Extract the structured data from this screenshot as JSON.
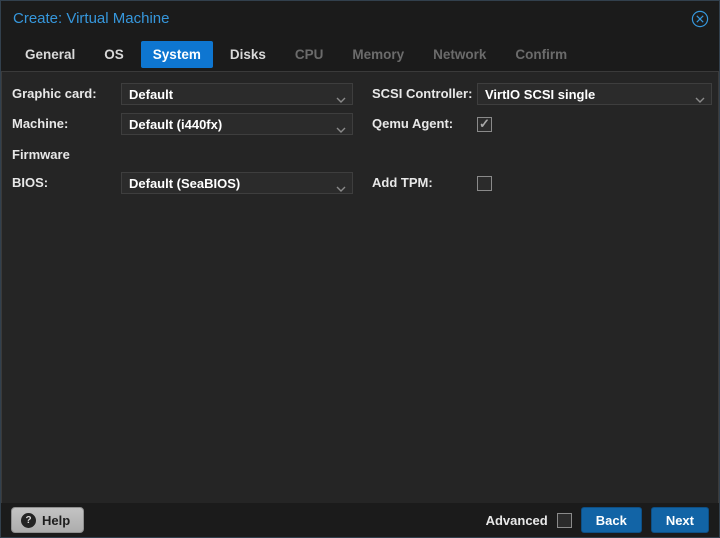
{
  "dialog": {
    "title": "Create: Virtual Machine"
  },
  "tabs": [
    {
      "label": "General",
      "state": "enabled"
    },
    {
      "label": "OS",
      "state": "enabled"
    },
    {
      "label": "System",
      "state": "active"
    },
    {
      "label": "Disks",
      "state": "enabled"
    },
    {
      "label": "CPU",
      "state": "disabled"
    },
    {
      "label": "Memory",
      "state": "disabled"
    },
    {
      "label": "Network",
      "state": "disabled"
    },
    {
      "label": "Confirm",
      "state": "disabled"
    }
  ],
  "form": {
    "left": {
      "graphic_card": {
        "label": "Graphic card:",
        "value": "Default"
      },
      "machine": {
        "label": "Machine:",
        "value": "Default (i440fx)"
      },
      "firmware_heading": "Firmware",
      "bios": {
        "label": "BIOS:",
        "value": "Default (SeaBIOS)"
      }
    },
    "right": {
      "scsi_controller": {
        "label": "SCSI Controller:",
        "value": "VirtIO SCSI single"
      },
      "qemu_agent": {
        "label": "Qemu Agent:",
        "checked": true
      },
      "add_tpm": {
        "label": "Add TPM:",
        "checked": false
      }
    }
  },
  "footer": {
    "help_label": "Help",
    "advanced": {
      "label": "Advanced",
      "checked": false
    },
    "back_label": "Back",
    "next_label": "Next"
  },
  "icons": {
    "help_icon": "?",
    "check_icon": "✓"
  },
  "colors": {
    "title_blue": "#3697dc",
    "active_tab_blue": "#0e76d1",
    "button_blue": "#1264a6"
  }
}
